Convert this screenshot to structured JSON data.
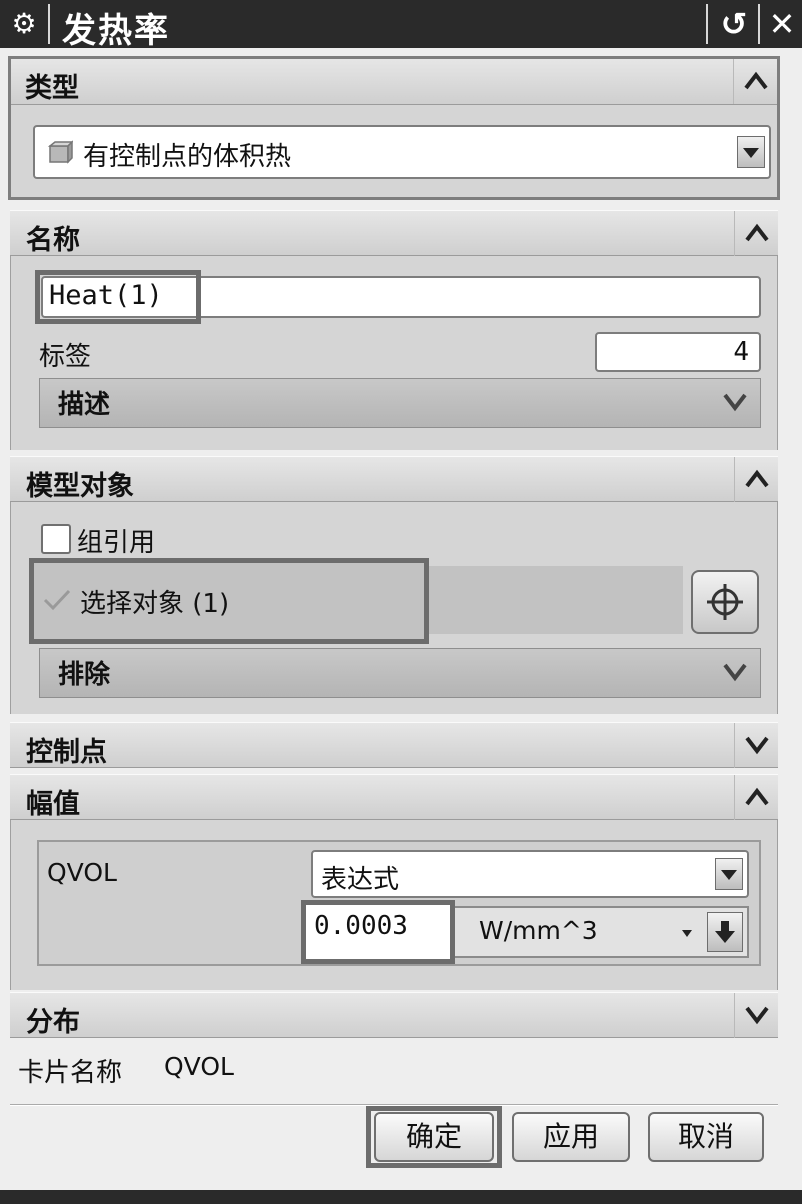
{
  "titlebar": {
    "title": "发热率",
    "gear_icon": "gear-icon",
    "reset_icon": "reset-icon",
    "close_icon": "close-icon"
  },
  "type_section": {
    "label": "类型",
    "selected": "有控制点的体积热"
  },
  "name_section": {
    "label": "名称",
    "name_value": "Heat(1)",
    "tag_label": "标签",
    "tag_value": "4",
    "description_label": "描述"
  },
  "model_section": {
    "label": "模型对象",
    "group_ref_label": "组引用",
    "group_ref_checked": false,
    "select_label": "选择对象 (1)",
    "exclude_label": "排除"
  },
  "control_points_section": {
    "label": "控制点"
  },
  "magnitude_section": {
    "label": "幅值",
    "variable": "QVOL",
    "method": "表达式",
    "value": "0.0003",
    "unit": "W/mm^3"
  },
  "distribution_section": {
    "label": "分布"
  },
  "card_name": {
    "label": "卡片名称",
    "value": "QVOL"
  },
  "buttons": {
    "ok": "确定",
    "apply": "应用",
    "cancel": "取消"
  }
}
